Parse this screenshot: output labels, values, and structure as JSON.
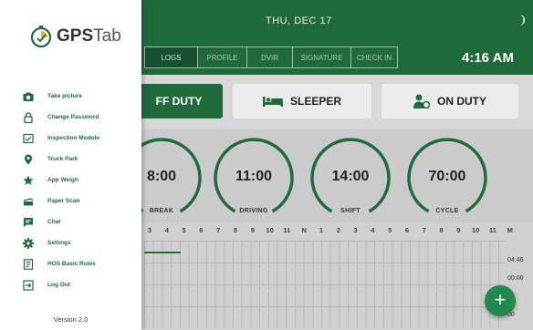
{
  "header": {
    "date": "THU, DEC 17",
    "clock": "4:16 AM"
  },
  "tabs": [
    {
      "label": "LOGS",
      "active": true
    },
    {
      "label": "PROFILE",
      "active": false
    },
    {
      "label": "DVIR",
      "active": false
    },
    {
      "label": "SIGNATURE",
      "active": false
    },
    {
      "label": "CHECK IN",
      "active": false
    }
  ],
  "duty": {
    "off": "FF DUTY",
    "sleeper": "SLEEPER",
    "on": "ON DUTY"
  },
  "gauges": [
    {
      "value": "8:00",
      "label": "BREAK"
    },
    {
      "value": "11:00",
      "label": "DRIVING"
    },
    {
      "value": "14:00",
      "label": "SHIFT"
    },
    {
      "value": "70:00",
      "label": "CYCLE"
    }
  ],
  "timeline": {
    "hours": [
      "3",
      "4",
      "5",
      "6",
      "7",
      "8",
      "9",
      "10",
      "11",
      "N",
      "1",
      "2",
      "3",
      "4",
      "5",
      "6",
      "7",
      "8",
      "9",
      "10",
      "11",
      "M"
    ],
    "totals": [
      "04:46",
      "00:00",
      "00",
      "00"
    ]
  },
  "drawer": {
    "brand_gps": "GPS",
    "brand_tab": "Tab",
    "menu": [
      {
        "label": "Take picture",
        "icon": "camera-icon"
      },
      {
        "label": "Change Password",
        "icon": "lock-icon"
      },
      {
        "label": "Inspection Module",
        "icon": "inspection-icon"
      },
      {
        "label": "Truck Park",
        "icon": "location-pin-icon"
      },
      {
        "label": "App Weigh",
        "icon": "star-icon"
      },
      {
        "label": "Paper Scan",
        "icon": "scanner-icon"
      },
      {
        "label": "Chat",
        "icon": "chat-icon"
      },
      {
        "label": "Settings",
        "icon": "gear-icon"
      },
      {
        "label": "HOS Basic Rules",
        "icon": "rules-icon"
      },
      {
        "label": "Log Out",
        "icon": "logout-icon"
      }
    ],
    "version": "Version 2.0"
  },
  "colors": {
    "brand_green": "#1e6a3b",
    "accent_green": "#1f8a4c"
  }
}
